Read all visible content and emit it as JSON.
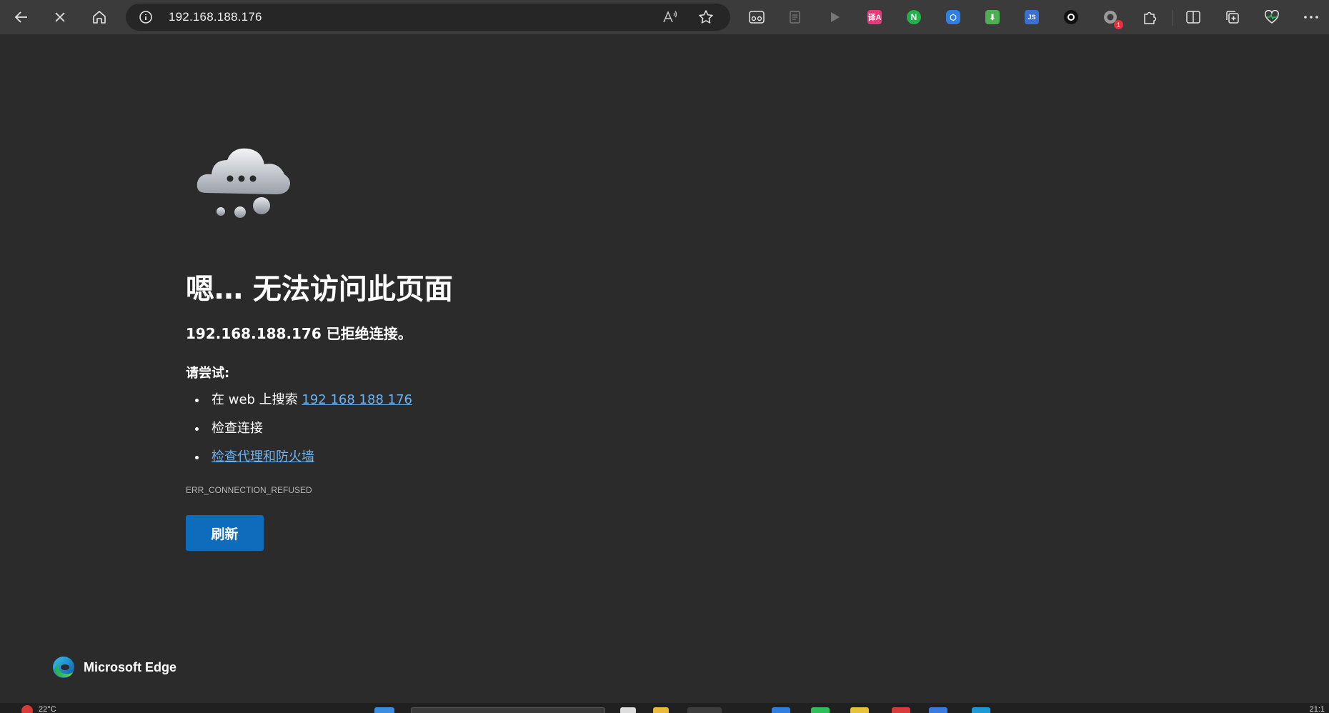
{
  "browser": {
    "address": "192.168.188.176",
    "extensions": [
      {
        "name": "immersive-reader-icon"
      },
      {
        "name": "translate-extension-icon",
        "label": "译A",
        "color": "#e33a7a"
      },
      {
        "name": "n-extension-icon",
        "label": "N",
        "color": "#22b14c"
      },
      {
        "name": "cube-extension-icon",
        "label": "⬡",
        "color": "#2f7ee0"
      },
      {
        "name": "download-extension-icon",
        "label": "⬇",
        "color": "#4caf50"
      },
      {
        "name": "js-extension-icon",
        "label": "JS",
        "color": "#3b6fd1"
      },
      {
        "name": "circle-extension-icon"
      },
      {
        "name": "record-extension-icon",
        "badge": "1"
      }
    ]
  },
  "error_page": {
    "heading": "嗯… 无法访问此页面",
    "subheading": "192.168.188.176 已拒绝连接。",
    "try_label": "请尝试:",
    "suggestions": {
      "search_prefix": "在 web 上搜索 ",
      "search_link": "192 168 188 176",
      "check_connection": "检查连接",
      "check_proxy": "检查代理和防火墙"
    },
    "error_code": "ERR_CONNECTION_REFUSED",
    "refresh_label": "刷新"
  },
  "branding": {
    "name": "Microsoft Edge"
  },
  "taskbar": {
    "weather": "22°C",
    "clock": "21:1"
  },
  "colors": {
    "accent": "#0f6cbd",
    "link": "#6db3f2",
    "background": "#2b2b2b"
  }
}
